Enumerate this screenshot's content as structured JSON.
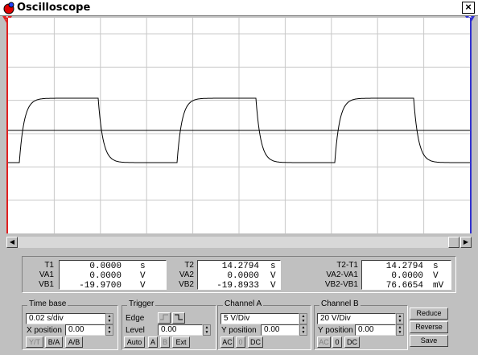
{
  "window": {
    "title": "Oscilloscope",
    "close_glyph": "×"
  },
  "markers": {
    "t1": "1",
    "t2": "2"
  },
  "colors": {
    "cursor1": "#e02020",
    "cursor2": "#3030d0",
    "trace": "#000000",
    "grid": "#c8c8c8",
    "screen": "#ffffff",
    "panel": "#c0c0c0"
  },
  "readouts": {
    "cursor1": {
      "labels": [
        "T1",
        "VA1",
        "VB1"
      ],
      "values": [
        "0.0000",
        "0.0000",
        "-19.9700"
      ],
      "units": [
        "s",
        "V",
        "V"
      ]
    },
    "cursor2": {
      "labels": [
        "T2",
        "VA2",
        "VB2"
      ],
      "values": [
        "14.2794",
        "0.0000",
        "-19.8933"
      ],
      "units": [
        "s",
        "V",
        "V"
      ]
    },
    "delta": {
      "labels": [
        "T2-T1",
        "VA2-VA1",
        "VB2-VB1"
      ],
      "values": [
        "14.2794",
        "0.0000",
        "76.6654"
      ],
      "units": [
        "s",
        "V",
        "mV"
      ]
    }
  },
  "timebase": {
    "title": "Time base",
    "value": "0.02 s/div",
    "xpos_label": "X position",
    "xpos": "0.00",
    "buttons": [
      "Y/T",
      "B/A",
      "A/B"
    ]
  },
  "trigger": {
    "title": "Trigger",
    "edge_label": "Edge",
    "level_label": "Level",
    "level": "0.00",
    "buttons": [
      "Auto",
      "A",
      "B",
      "Ext"
    ]
  },
  "channel_a": {
    "title": "Channel A",
    "value": "5 V/Div",
    "ypos_label": "Y position",
    "ypos": "0.00",
    "buttons": [
      "AC",
      "0",
      "DC"
    ]
  },
  "channel_b": {
    "title": "Channel B",
    "value": "20 V/Div",
    "ypos_label": "Y position",
    "ypos": "0.00",
    "buttons": [
      "AC",
      "0",
      "DC"
    ]
  },
  "actions": [
    "Reduce",
    "Reverse",
    "Save"
  ],
  "scrollbar": {
    "left_glyph": "◀",
    "right_glyph": "▶",
    "position": 0.95
  }
}
